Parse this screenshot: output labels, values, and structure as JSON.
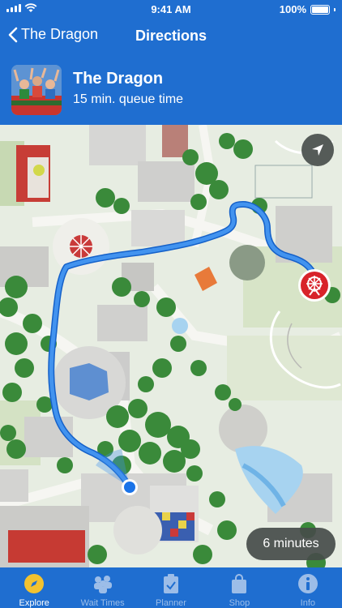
{
  "status": {
    "time": "9:41 AM",
    "battery": "100%"
  },
  "nav": {
    "back_label": "The Dragon",
    "title": "Directions"
  },
  "ride": {
    "name": "The Dragon",
    "queue": "15 min. queue time"
  },
  "map": {
    "eta": "6 minutes",
    "route_color": "#2f7de0",
    "destination_marker_color": "#d8232a"
  },
  "tabs": [
    {
      "label": "Explore",
      "icon": "compass-icon",
      "active": true
    },
    {
      "label": "Wait Times",
      "icon": "people-icon",
      "active": false
    },
    {
      "label": "Planner",
      "icon": "clipboard-check-icon",
      "active": false
    },
    {
      "label": "Shop",
      "icon": "shopping-bag-icon",
      "active": false
    },
    {
      "label": "Info",
      "icon": "info-icon",
      "active": false
    }
  ],
  "colors": {
    "brand": "#1f6ed0",
    "inactive_tab": "#9cbde8"
  }
}
